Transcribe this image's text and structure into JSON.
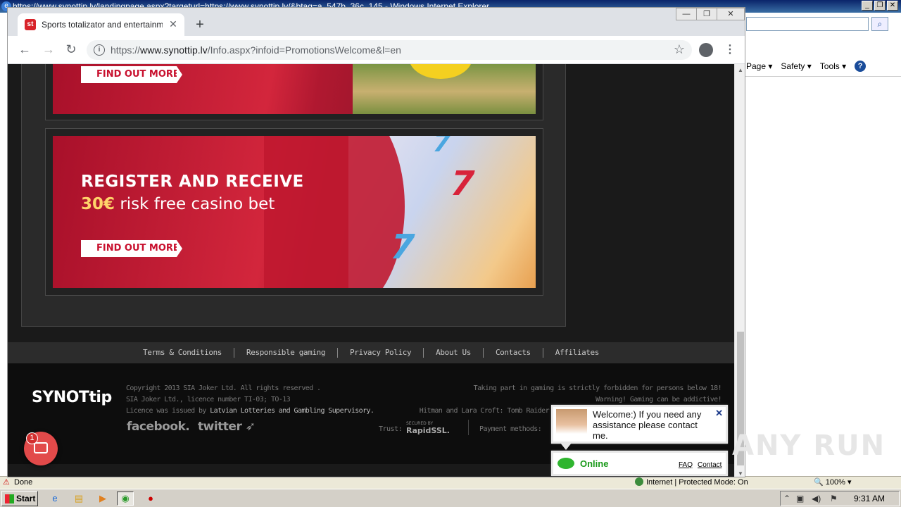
{
  "ie": {
    "title": "https://www.synottip.lv/landingpage.aspx?targeturl=https://www.synottip.lv/&btag=a_547b_36c_145 - Windows Internet Explorer",
    "menu": [
      "Page ▾",
      "Safety ▾",
      "Tools ▾"
    ],
    "status_done": "Done",
    "status_zone": "Internet | Protected Mode: On",
    "zoom": "100%"
  },
  "chrome": {
    "tab_title": "Sports totalizator and entertainment",
    "favicon": "st",
    "url_scheme": "https://",
    "url_host": "www.synottip.lv",
    "url_path": "/Info.aspx?infoid=PromotionsWelcome&l=en"
  },
  "banners": {
    "first_button": "FIND OUT MORE",
    "second_line1": "REGISTER AND RECEIVE",
    "second_amount": "30€",
    "second_line2": "risk free casino bet",
    "second_button": "FIND OUT MORE"
  },
  "footer_nav": [
    "Terms & Conditions",
    "Responsible gaming",
    "Privacy Policy",
    "About Us",
    "Contacts",
    "Affiliates"
  ],
  "footer": {
    "logo": "SYNOTtip",
    "copyright": "Copyright 2013 SIA Joker Ltd. All rights reserved .",
    "licence": "SIA Joker Ltd., licence number TI-03; TO-13",
    "issued_prefix": "Licence was issued by ",
    "issued_link": "Latvian Lotteries and Gambling Supervisory.",
    "warn1": "Taking part in gaming is strictly forbidden for persons below 18!",
    "warn2": "Warning! Gaming can be addictive!",
    "warn3": "Hitman and Lara Croft: Tomb Raider",
    "facebook": "facebook.",
    "twitter": "twitter",
    "trust": "Trust:",
    "rapid_small": "SECURED BY",
    "rapid": "RapidSSL.",
    "payment": "Payment methods:"
  },
  "chat": {
    "badge": "1",
    "welcome": "Welcome:) If you need any assistance please contact me.",
    "status": "Online",
    "faq": "FAQ",
    "contact": "Contact"
  },
  "taskbar": {
    "start": "Start",
    "clock": "9:31 AM"
  },
  "watermark": "ANY RUN"
}
